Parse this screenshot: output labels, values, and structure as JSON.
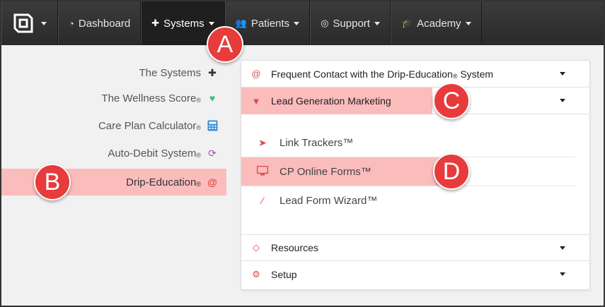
{
  "nav": {
    "items": [
      {
        "label": "Dashboard",
        "icon": "dashboard-icon"
      },
      {
        "label": "Systems",
        "icon": "puzzle-icon"
      },
      {
        "label": "Patients",
        "icon": "users-icon"
      },
      {
        "label": "Support",
        "icon": "lifebuoy-icon"
      },
      {
        "label": "Academy",
        "icon": "graduation-cap-icon"
      }
    ]
  },
  "sidebar": {
    "items": [
      {
        "label": "The Systems",
        "reg": "",
        "icon": "puzzle-icon"
      },
      {
        "label": "The Wellness Score",
        "reg": "®",
        "icon": "heart-pulse-icon"
      },
      {
        "label": "Care Plan Calculator",
        "reg": "®",
        "icon": "calculator-icon"
      },
      {
        "label": "Auto-Debit System",
        "reg": "®",
        "icon": "refresh-icon"
      },
      {
        "label": "Drip-Education",
        "reg": "®",
        "icon": "at-icon"
      }
    ]
  },
  "accordion": {
    "frequent_contact": {
      "label_main": "Frequent Contact with the Drip-Education",
      "reg": "®",
      "label_tail": " System"
    },
    "lead_generation": "Lead Generation Marketing",
    "subitems": [
      "Link Trackers™",
      "CP Online Forms™",
      "Lead Form Wizard™"
    ],
    "resources": "Resources",
    "setup": "Setup"
  },
  "badges": {
    "a": "A",
    "b": "B",
    "c": "C",
    "d": "D"
  },
  "colors": {
    "highlight": "#fbbcbc",
    "badge": "#e83b3b",
    "accent": "#e04848",
    "nav_bg": "#333333"
  }
}
